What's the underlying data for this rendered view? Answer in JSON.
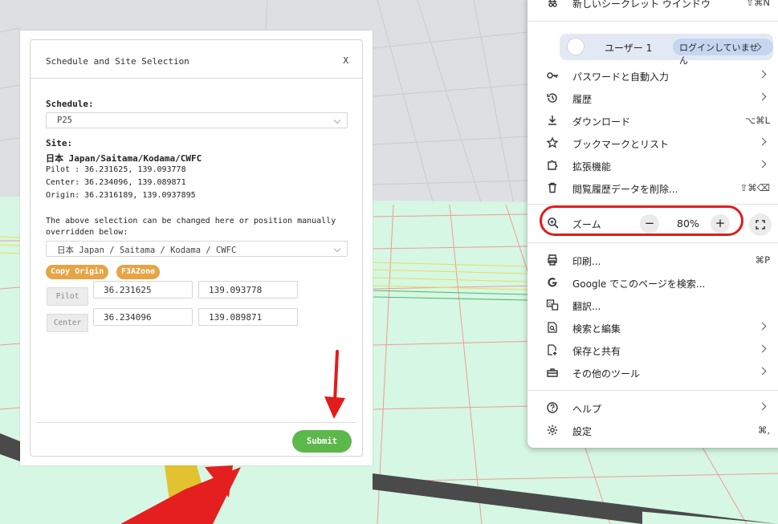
{
  "modal": {
    "title": "Schedule and Site Selection",
    "close_label": "X",
    "schedule_label": "Schedule:",
    "schedule_value": "P25",
    "site_label": "Site:",
    "site_name": "日本 Japan/Saitama/Kodama/CWFC",
    "pilot_line": "Pilot : 36.231625, 139.093778",
    "center_line": "Center: 36.234096, 139.089871",
    "origin_line": "Origin: 36.2316189, 139.0937895",
    "hint_line1": "The above selection can be changed here or position manually",
    "hint_line2": "overridden below:",
    "site_select_value": "日本 Japan / Saitama / Kodama / CWFC",
    "copy_origin_label": "Copy Origin",
    "f3azone_label": "F3AZone",
    "pilot_addon": "Pilot",
    "pilot_lat": "36.231625",
    "pilot_lon": "139.093778",
    "center_addon": "Center",
    "center_lat": "36.234096",
    "center_lon": "139.089871",
    "submit_label": "Submit"
  },
  "menu": {
    "incognito": {
      "label": "新しいシークレット ウインドウ",
      "shortcut": "⇧⌘N"
    },
    "user": {
      "name": "ユーザー 1",
      "status": "ログインしていません"
    },
    "items_a": [
      {
        "label": "パスワードと自動入力",
        "icon": "key-icon",
        "shortcut": ""
      },
      {
        "label": "履歴",
        "icon": "history-icon",
        "shortcut": ""
      },
      {
        "label": "ダウンロード",
        "icon": "download-icon",
        "shortcut": "⌥⌘L"
      },
      {
        "label": "ブックマークとリスト",
        "icon": "star-icon",
        "shortcut": ""
      },
      {
        "label": "拡張機能",
        "icon": "puzzle-icon",
        "shortcut": ""
      },
      {
        "label": "閲覧履歴データを削除...",
        "icon": "trash-icon",
        "shortcut": "⇧⌘⌫"
      }
    ],
    "zoom": {
      "label": "ズーム",
      "minus": "−",
      "value": "80%",
      "plus": "+"
    },
    "items_b": [
      {
        "label": "印刷...",
        "icon": "print-icon",
        "shortcut": "⌘P"
      },
      {
        "label": "Google でこのページを検索...",
        "icon": "google-icon",
        "shortcut": ""
      },
      {
        "label": "翻訳...",
        "icon": "translate-icon",
        "shortcut": ""
      },
      {
        "label": "検索と編集",
        "icon": "search-edit-icon",
        "shortcut": ""
      },
      {
        "label": "保存と共有",
        "icon": "save-share-icon",
        "shortcut": ""
      },
      {
        "label": "その他のツール",
        "icon": "toolbox-icon",
        "shortcut": ""
      }
    ],
    "items_c": [
      {
        "label": "ヘルプ",
        "icon": "help-icon",
        "shortcut": ""
      },
      {
        "label": "設定",
        "icon": "settings-icon",
        "shortcut": "⌘,"
      }
    ]
  },
  "colors": {
    "accent_orange": "#e6a445",
    "submit_green": "#5cb84a",
    "annotation_red": "#e21b1b",
    "ground_green": "#d6f7e3"
  }
}
